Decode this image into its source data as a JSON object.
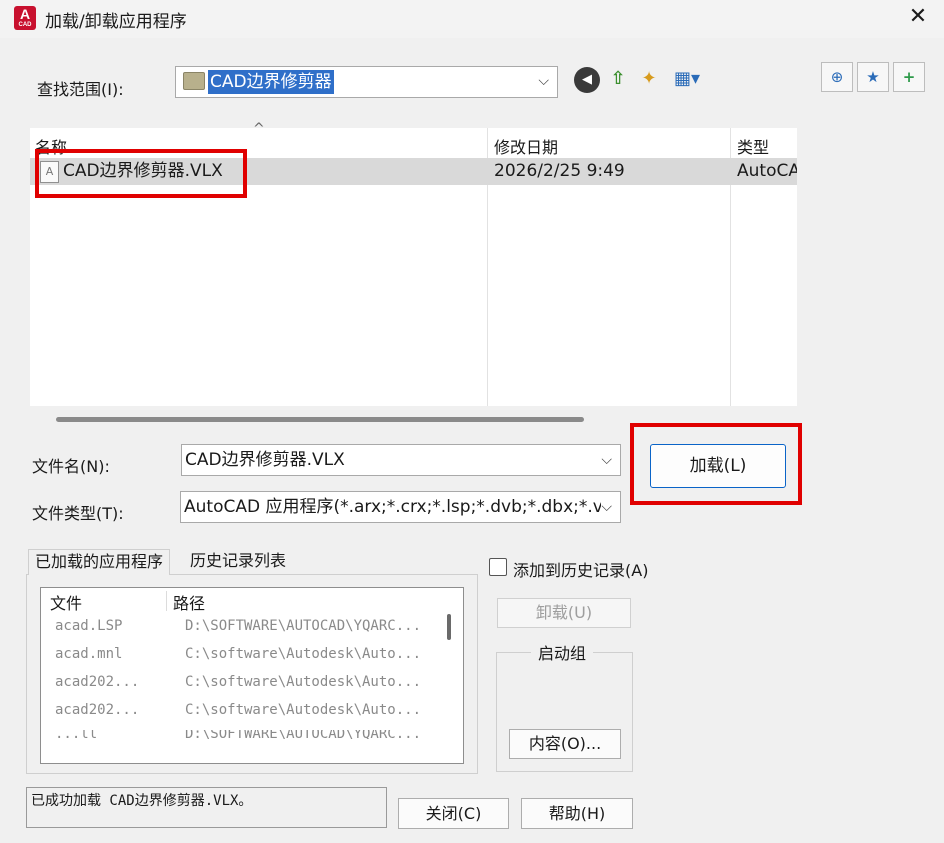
{
  "window": {
    "title": "加载/卸载应用程序",
    "app_icon_letter": "A",
    "app_icon_caption": "CAD",
    "close_glyph": "✕"
  },
  "lookin": {
    "label": "查找范围(I):",
    "value": "CAD边界修剪器",
    "dropdown_glyph": "⌵"
  },
  "toolbar": {
    "back_glyph": "◀",
    "up_glyph": "⇧",
    "new_folder_glyph": "✦",
    "views_glyph": "▦▾",
    "search_web_glyph": "⊕",
    "favorites_glyph": "★",
    "add_favorites_glyph": "+"
  },
  "file_list": {
    "columns": [
      "名称",
      "修改日期",
      "类型"
    ],
    "sort_glyph": "^",
    "rows": [
      {
        "name": "CAD边界修剪器.VLX",
        "date": "2026/2/25 9:49",
        "type": "AutoCA"
      }
    ],
    "row_icon_letter": "A"
  },
  "filename": {
    "label": "文件名(N):",
    "value": "CAD边界修剪器.VLX"
  },
  "filetype": {
    "label": "文件类型(T):",
    "value": "AutoCAD 应用程序(*.arx;*.crx;*.lsp;*.dvb;*.dbx;*.v"
  },
  "load_button": "加载(L)",
  "tabs": {
    "loaded": "已加载的应用程序",
    "history": "历史记录列表"
  },
  "loaded_list": {
    "columns": [
      "文件",
      "路径"
    ],
    "rows": [
      {
        "file": "acad.LSP",
        "path": "D:\\SOFTWARE\\AUTOCAD\\YQARC..."
      },
      {
        "file": "acad.mnl",
        "path": "C:\\software\\Autodesk\\Auto..."
      },
      {
        "file": "acad202...",
        "path": "C:\\software\\Autodesk\\Auto..."
      },
      {
        "file": "acad202...",
        "path": "C:\\software\\Autodesk\\Auto..."
      },
      {
        "file": "...ll",
        "path": "D:\\SOFTWARE\\AUTOCAD\\YQARC..."
      }
    ]
  },
  "add_history_label": "添加到历史记录(A)",
  "unload_button": "卸载(U)",
  "startup_group": {
    "title": "启动组",
    "contents_button": "内容(O)..."
  },
  "status_text": "已成功加载 CAD边界修剪器.VLX。",
  "close_button": "关闭(C)",
  "help_button": "帮助(H)",
  "colors": {
    "highlight_box": "#e00000",
    "selection_blue": "#2f6fc9"
  }
}
